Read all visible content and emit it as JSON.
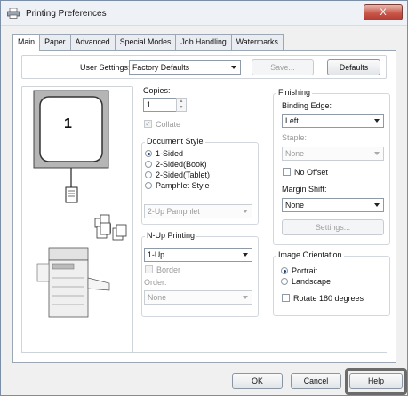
{
  "window": {
    "title": "Printing Preferences",
    "close_label": "X"
  },
  "tabs": [
    {
      "label": "Main"
    },
    {
      "label": "Paper"
    },
    {
      "label": "Advanced"
    },
    {
      "label": "Special Modes"
    },
    {
      "label": "Job Handling"
    },
    {
      "label": "Watermarks"
    }
  ],
  "user_settings": {
    "label": "User Settings:",
    "value": "Factory Defaults",
    "save_label": "Save...",
    "defaults_label": "Defaults"
  },
  "preview": {
    "page_number": "1"
  },
  "copies": {
    "label": "Copies:",
    "value": "1",
    "collate_label": "Collate",
    "collate_checked": true
  },
  "document_style": {
    "title": "Document Style",
    "options": [
      {
        "label": "1-Sided",
        "selected": true
      },
      {
        "label": "2-Sided(Book)",
        "selected": false
      },
      {
        "label": "2-Sided(Tablet)",
        "selected": false
      },
      {
        "label": "Pamphlet Style",
        "selected": false
      }
    ],
    "pamphlet_value": "2-Up Pamphlet"
  },
  "nup": {
    "title": "N-Up Printing",
    "value": "1-Up",
    "border_label": "Border",
    "order_label": "Order:",
    "order_value": "None"
  },
  "finishing": {
    "title": "Finishing",
    "binding_label": "Binding Edge:",
    "binding_value": "Left",
    "staple_label": "Staple:",
    "staple_value": "None",
    "no_offset_label": "No Offset",
    "margin_label": "Margin Shift:",
    "margin_value": "None",
    "settings_label": "Settings..."
  },
  "orientation": {
    "title": "Image Orientation",
    "options": [
      {
        "label": "Portrait",
        "selected": true
      },
      {
        "label": "Landscape",
        "selected": false
      }
    ],
    "rotate_label": "Rotate 180 degrees"
  },
  "buttons": {
    "ok": "OK",
    "cancel": "Cancel",
    "help": "Help"
  },
  "colors": {
    "highlight": "#6b6b6b",
    "accent": "#1f3f78"
  }
}
